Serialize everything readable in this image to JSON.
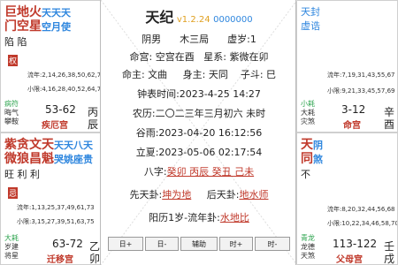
{
  "title": {
    "name": "天纪",
    "version": "v1.2.24",
    "code": "0000000"
  },
  "center": {
    "gender": "阴男",
    "bureau": "木三局",
    "xu": "虚岁:1",
    "ming_gong": "命宫: 空宫在酉",
    "xing_xi": "星系: 紫微在卯",
    "ming_zhu": "命主: 文曲",
    "shen_zhu": "身主: 天同",
    "zi_dou": "子斗: 巳",
    "clock_time": "钟表时间:2023-4-25 14:27",
    "lunar": "农历:二〇二三年三月初六 未时",
    "solar": "谷雨:2023-04-20 16:12:56",
    "lixia": "立夏:2023-05-06 02:17:54",
    "bazi_label": "八字:",
    "bazi_value": "癸卯 丙辰 癸丑 己未",
    "xiantian_label": "先天卦:",
    "xiantian_value": "坤为地",
    "houtian_label": "后天卦:",
    "houtian_value": "地水师",
    "yangyang_label": "阳历1岁-流年卦:",
    "yangyang_value": "水地比"
  },
  "buttons": [
    "日+",
    "日-",
    "辅助",
    "时+",
    "时-"
  ],
  "cells": {
    "tl": {
      "stars_line1": "巨地火",
      "stars_line1_blue": "天天天",
      "stars_line2": "门空星",
      "stars_line2_blue": "空月使",
      "tags": "陷    陷",
      "seal": "权",
      "liunian": "流年:2,14,26,38,50,62,74,86",
      "xiaoxian": "小限:4,16,28,40,52,64,76,88",
      "minor1": "病符",
      "minor2": "晦气",
      "minor3": "攀鞍",
      "range": "53-62",
      "palace": "疾厄宫",
      "gz1": "丙",
      "gz2": "辰"
    },
    "tr": {
      "stars_line1": "天封",
      "stars_line2": "虚诰",
      "liunian": "流年:7,19,31,43,55,67",
      "xiaoxian": "小限:9,21,33,45,57,69",
      "minor1": "小耗",
      "minor2": "大耗",
      "minor3": "灾煞",
      "range": "3-12",
      "palace": "命宫",
      "gz1": "辛",
      "gz2": "酉"
    },
    "ml": {
      "stars_line1": "紫贪文天",
      "stars_line1_blue": "天天八天",
      "stars_line2": "微狼昌魁",
      "stars_line2_blue": "哭姚座贵",
      "tags": "旺 利 利",
      "seal": "忌",
      "liunian": "流年:1,13,25,37,49,61,73",
      "xiaoxian": "小限:3,15,27,39,51,63,75"
    },
    "mr": {
      "stars_line1": "天",
      "stars_line2": "同",
      "stars_line1b": "阴",
      "stars_line2b": "煞",
      "tags": "不",
      "liunian": "流年:8,20,32,44,56,68",
      "xiaoxian": "小限:10,22,34,46,58,70"
    },
    "bl": {
      "minor1": "大耗",
      "minor2": "岁建",
      "minor3": "将星",
      "range": "63-72",
      "palace": "迁移宫",
      "gz1": "乙",
      "gz2": "卯"
    },
    "br": {
      "minor1": "青龙",
      "minor2": "龙德",
      "minor3": "天煞",
      "range": "113-122",
      "palace": "父母宫",
      "gz1": "壬",
      "gz2": "戌"
    }
  }
}
